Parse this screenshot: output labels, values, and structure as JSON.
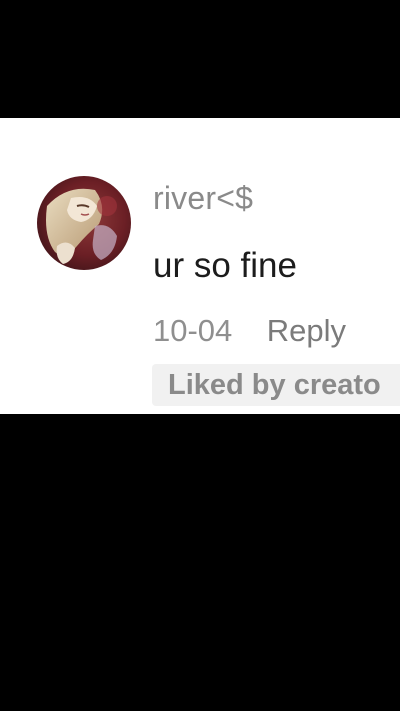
{
  "comment": {
    "username": "river<$",
    "text": "ur so fine",
    "timestamp": "10-04",
    "reply_label": "Reply",
    "liked_badge": "Liked by creato",
    "avatar_icon": "profile-avatar-image"
  },
  "colors": {
    "background": "#000000",
    "card": "#ffffff",
    "username": "#8a8a8a",
    "text": "#1c1c1c",
    "badge_bg": "#f1f1f1"
  }
}
